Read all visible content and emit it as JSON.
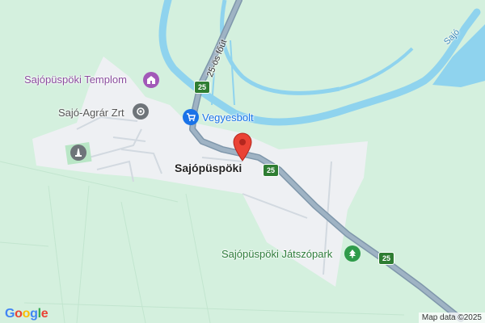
{
  "town": {
    "name": "Sajópüspöki"
  },
  "places": {
    "church": "Sajópüspöki Templom",
    "company": "Sajó-Agrár Zrt",
    "shop": "Vegyesbolt",
    "playground": "Sajópüspöki Játszópark"
  },
  "roads": {
    "main_name": "25-ös főút",
    "route_number": "25"
  },
  "water": {
    "river_name": "Sajó"
  },
  "footer": {
    "logo": "Google",
    "attribution": "Map data ©2025"
  },
  "colors": {
    "land": "#d4f0de",
    "urban": "#eef0f3",
    "water": "#8fd3ee",
    "highway": "#8da2b4",
    "route_shield": "#2e7d32",
    "pin": "#ea4335",
    "church_icon": "#a259b8",
    "shop_icon": "#1a73e8",
    "park_icon": "#2f9b4a",
    "company_icon": "#6e7479"
  },
  "icons": {
    "church": "church-icon",
    "company": "building-icon",
    "shop": "shopping-cart-icon",
    "playground": "tree-icon",
    "monument": "monument-icon",
    "pin": "map-pin-icon"
  }
}
